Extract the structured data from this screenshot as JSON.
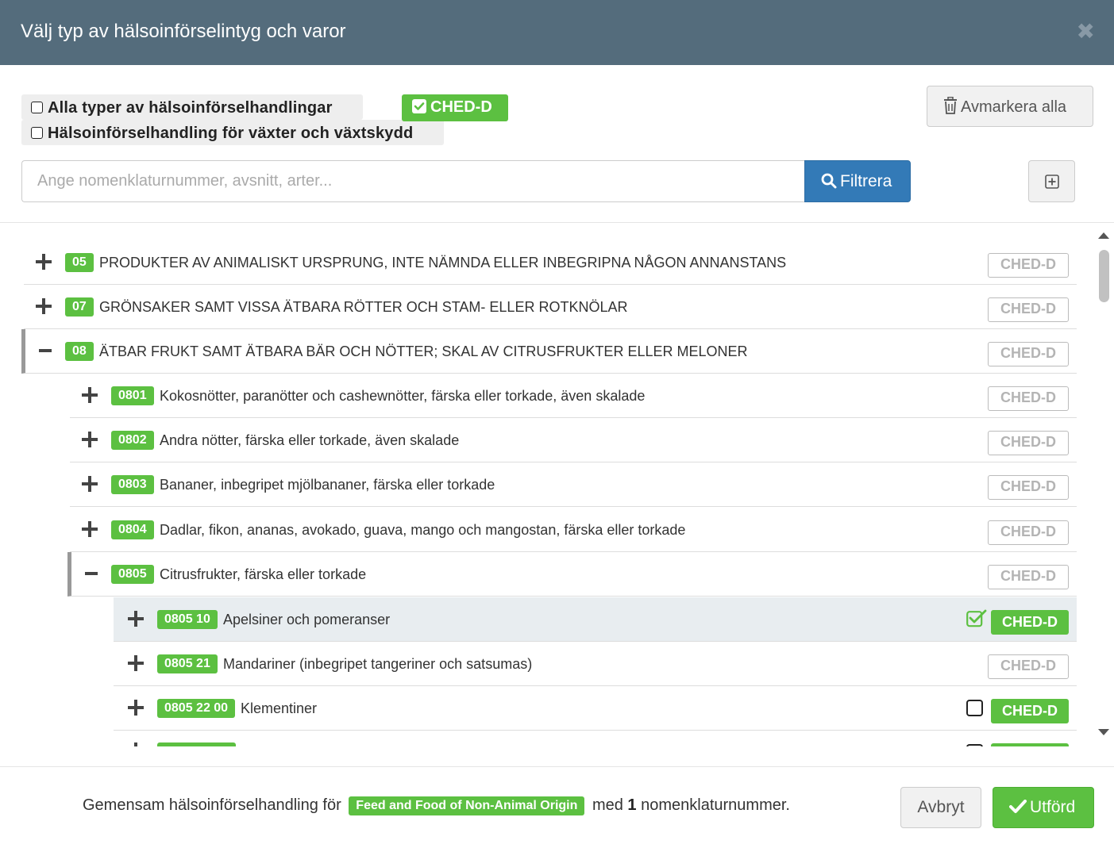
{
  "dialog": {
    "title": "Välj typ av hälsoinförselintyg och varor",
    "close_icon": "close-icon"
  },
  "certificate_types": {
    "all_label": "Alla typer av hälsoinförselhandlingar",
    "plants_label": "Hälsoinförselhandling för växter och växtskydd",
    "active_filter": "CHED-D",
    "clear_all_label": "Avmarkera alla"
  },
  "search": {
    "placeholder": "Ange nomenklaturnummer, avsnitt, arter...",
    "filter_label": "Filtrera"
  },
  "tree": [
    {
      "code": "05",
      "label": "PRODUKTER AV ANIMALISKT URSPRUNG, INTE NÄMNDA ELLER INBEGRIPNA NÅGON ANNANSTANS",
      "badge": "CHED-D",
      "state": "collapsed"
    },
    {
      "code": "07",
      "label": "GRÖNSAKER SAMT VISSA ÄTBARA RÖTTER OCH STAM- ELLER ROTKNÖLAR",
      "badge": "CHED-D",
      "state": "collapsed"
    },
    {
      "code": "08",
      "label": "ÄTBAR FRUKT SAMT ÄTBARA BÄR OCH NÖTTER; SKAL AV CITRUSFRUKTER ELLER MELONER",
      "badge": "CHED-D",
      "state": "expanded"
    },
    {
      "code": "0801",
      "label": "Kokosnötter, paranötter och cashewnötter, färska eller torkade, även skalade",
      "badge": "CHED-D",
      "state": "collapsed"
    },
    {
      "code": "0802",
      "label": "Andra nötter, färska eller torkade, även skalade",
      "badge": "CHED-D",
      "state": "collapsed"
    },
    {
      "code": "0803",
      "label": "Bananer, inbegripet mjölbananer, färska eller torkade",
      "badge": "CHED-D",
      "state": "collapsed"
    },
    {
      "code": "0804",
      "label": "Dadlar, fikon, ananas, avokado, guava, mango och mangostan, färska eller torkade",
      "badge": "CHED-D",
      "state": "collapsed"
    },
    {
      "code": "0805",
      "label": "Citrusfrukter, färska eller torkade",
      "badge": "CHED-D",
      "state": "expanded"
    },
    {
      "code": "0805 10",
      "label": "Apelsiner och pomeranser",
      "badge": "CHED-D",
      "state": "collapsed",
      "checked": true
    },
    {
      "code": "0805 21",
      "label": "Mandariner (inbegripet tangeriner och satsumas)",
      "badge": "CHED-D",
      "state": "collapsed"
    },
    {
      "code": "0805 22 00",
      "label": "Klementiner",
      "badge": "CHED-D",
      "state": "collapsed",
      "checked": false
    }
  ],
  "footer": {
    "text_before": "Gemensam hälsoinförselhandling för",
    "category_badge": "Feed and Food of Non-Animal Origin",
    "text_med": "med",
    "count": "1",
    "text_after": "nomenklaturnummer.",
    "cancel_label": "Avbryt",
    "done_label": "Utförd"
  },
  "colors": {
    "header_bg": "#546c7c",
    "green": "#5cc041",
    "primary_blue": "#337ab7",
    "selected_row_bg": "#e8edf0"
  }
}
